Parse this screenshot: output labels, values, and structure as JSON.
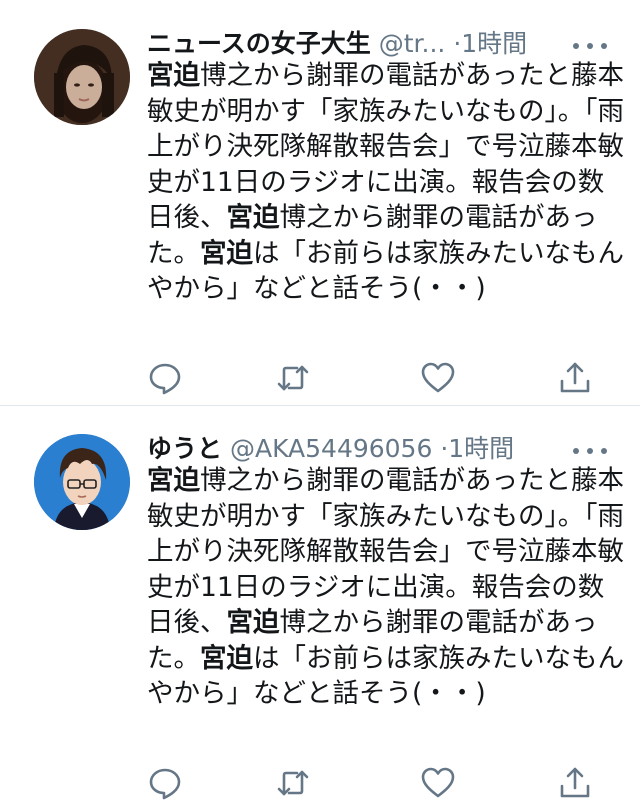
{
  "tweets": [
    {
      "display_name": "ニュースの女子大生",
      "handle": "@tr...",
      "separator": "·",
      "time": "1時間",
      "segments": [
        {
          "text": "宮迫",
          "hl": true
        },
        {
          "text": "博之から謝罪の電話があったと藤本敏史が明かす「家族みたいなもの」。「雨上がり決死隊解散報告会」で号泣藤本敏史が11日のラジオに出演。報告会の数日後、",
          "hl": false
        },
        {
          "text": "宮迫",
          "hl": true
        },
        {
          "text": "博之から謝罪の電話があった。",
          "hl": false
        },
        {
          "text": "宮迫",
          "hl": true
        },
        {
          "text": "は「お前らは家族みたいなもんやから」などと話そう(・・)",
          "hl": false
        }
      ],
      "avatar_icon": "female-user-avatar"
    },
    {
      "display_name": "ゆうと",
      "handle": "@AKA54496056",
      "separator": "·",
      "time": "1時間",
      "segments": [
        {
          "text": "宮迫",
          "hl": true
        },
        {
          "text": "博之から謝罪の電話があったと藤本敏史が明かす「家族みたいなもの」。「雨上がり決死隊解散報告会」で号泣藤本敏史が11日のラジオに出演。報告会の数日後、",
          "hl": false
        },
        {
          "text": "宮迫",
          "hl": true
        },
        {
          "text": "博之から謝罪の電話があった。",
          "hl": false
        },
        {
          "text": "宮迫",
          "hl": true
        },
        {
          "text": "は「お前らは家族みたいなもんやから」などと話そう(・・)",
          "hl": false
        }
      ],
      "avatar_icon": "anime-man-avatar"
    }
  ],
  "icons": {
    "reply": "reply-icon",
    "retweet": "retweet-icon",
    "like": "like-icon",
    "share": "share-icon",
    "more": "more-icon"
  },
  "colors": {
    "text": "#14171a",
    "secondary": "#657786",
    "icon": "#657786",
    "divider": "#e1e8ed"
  }
}
